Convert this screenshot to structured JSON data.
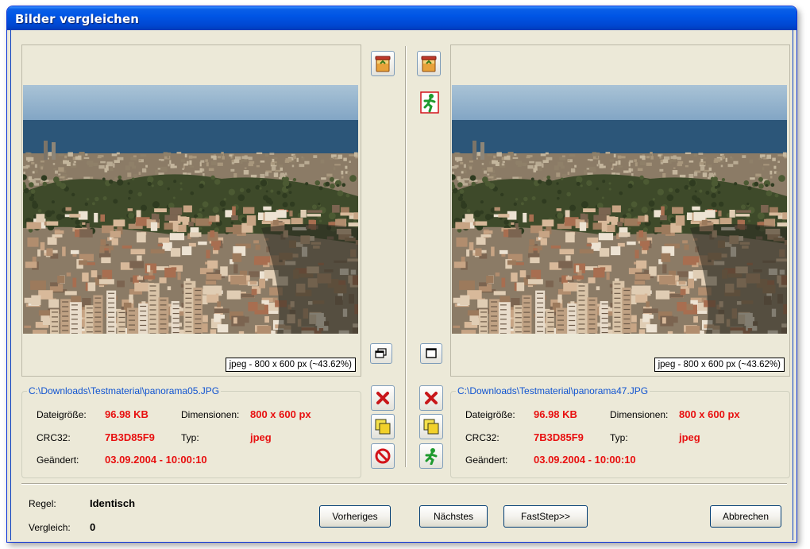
{
  "window": {
    "title": "Bilder vergleichen"
  },
  "left": {
    "image_info": "jpeg - 800 x 600 px (~43.62%)",
    "path": "C:\\Downloads\\Testmaterial\\panorama05.JPG",
    "labels": {
      "size": "Dateigröße:",
      "dimensions": "Dimensionen:",
      "crc": "CRC32:",
      "type": "Typ:",
      "modified": "Geändert:"
    },
    "values": {
      "size": "96.98 KB",
      "dimensions": "800 x 600 px",
      "crc": "7B3D85F9",
      "type": "jpeg",
      "modified": "03.09.2004 - 10:00:10"
    }
  },
  "right": {
    "image_info": "jpeg - 800 x 600 px (~43.62%)",
    "path": "C:\\Downloads\\Testmaterial\\panorama47.JPG",
    "labels": {
      "size": "Dateigröße:",
      "dimensions": "Dimensionen:",
      "crc": "CRC32:",
      "type": "Typ:",
      "modified": "Geändert:"
    },
    "values": {
      "size": "96.98 KB",
      "dimensions": "800 x 600 px",
      "crc": "7B3D85F9",
      "type": "jpeg",
      "modified": "03.09.2004 - 10:00:10"
    }
  },
  "footer": {
    "rule_label": "Regel:",
    "rule_value": "Identisch",
    "compare_label": "Vergleich:",
    "compare_value": "0",
    "prev_button": "Vorheriges",
    "next_button": "Nächstes",
    "faststep_button": "FastStep>>",
    "cancel_button": "Abbrechen"
  },
  "icons": {
    "left_toolbar": [
      "recycle-bin-icon",
      "window-restore-icon",
      "delete-x-icon",
      "move-folder-icon",
      "stop-icon"
    ],
    "right_toolbar": [
      "recycle-bin-icon",
      "running-man-icon",
      "window-single-icon",
      "delete-x-icon",
      "move-folder-icon",
      "running-man-icon"
    ]
  },
  "colors": {
    "titlebar": "#0055e5",
    "path_link": "#1154d0",
    "value_red": "#e81010",
    "window_bg": "#ece9d8"
  }
}
